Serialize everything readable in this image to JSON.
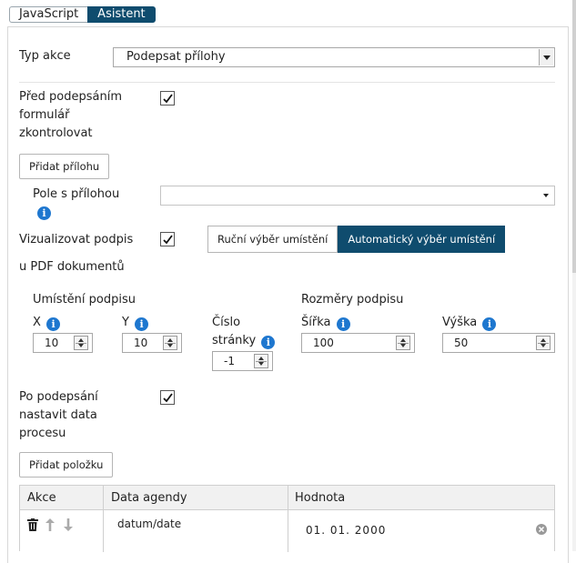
{
  "tabs": [
    {
      "label": "JavaScript",
      "active": false
    },
    {
      "label": "Asistent",
      "active": true
    }
  ],
  "action_type": {
    "label": "Typ akce",
    "value": "Podepsat přílohy"
  },
  "validate_before_sign": {
    "label_lines": [
      "Před podepsáním",
      "formulář",
      "zkontrolovat"
    ],
    "checked": true
  },
  "add_attachment_button": "Přidat přílohu",
  "attachment_field": {
    "label": "Pole s přílohou",
    "value": ""
  },
  "visualize_signature": {
    "label_lines": [
      "Vizualizovat podpis",
      "u PDF dokumentů"
    ],
    "checked": true
  },
  "placement_modes": [
    {
      "label": "Ruční výběr umístění",
      "active": false
    },
    {
      "label": "Automatický výběr umístění",
      "active": true
    }
  ],
  "signature_position": {
    "title": "Umístění podpisu",
    "x": {
      "label": "X",
      "value": "10"
    },
    "y": {
      "label": "Y",
      "value": "10"
    },
    "page": {
      "label_lines": [
        "Číslo",
        "stránky"
      ],
      "value": "-1"
    }
  },
  "signature_size": {
    "title": "Rozměry podpisu",
    "width": {
      "label": "Šířka",
      "value": "100"
    },
    "height": {
      "label": "Výška",
      "value": "50"
    }
  },
  "set_process_data": {
    "label_lines": [
      "Po podepsání",
      "nastavit data",
      "procesu"
    ],
    "checked": true
  },
  "add_item_button": "Přidat položku",
  "table": {
    "columns": [
      "Akce",
      "Data agendy",
      "Hodnota"
    ],
    "rows": [
      {
        "agenda_data": "datum/date",
        "value": "01. 01. 2000"
      }
    ]
  },
  "colors": {
    "accent": "#0f4c6e",
    "info": "#1e77cf"
  }
}
